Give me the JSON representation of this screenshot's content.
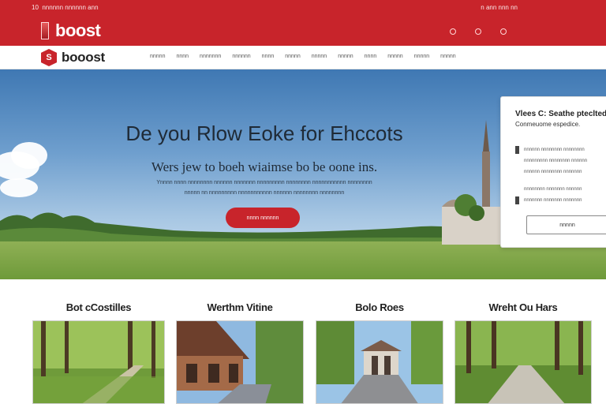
{
  "topbar": {
    "left_text": "10   nnnnnn  nnnnnn  ann",
    "right_text": "n  ann nnn nn",
    "brand": "boost"
  },
  "nav": {
    "logo_letter": "S",
    "logo_text": "booost",
    "links": [
      "nnnnn",
      "nnnn",
      "nnnnnnn",
      "nnnnnn",
      "nnnn",
      "nnnnn",
      "nnnnn",
      "nnnnn",
      "nnnn",
      "nnnnn",
      "nnnnn",
      "nnnnn"
    ]
  },
  "hero": {
    "title": "De you Rlow Eoke for Ehccots",
    "subtitle": "Wers jew to boeh wiaimse bo be oone ins.",
    "line1": "Ynnnn nnnn nnnnnnnn nnnnnn nnnnnnn nnnnnnnnn nnnnnnnn nnnnnnnnnnn nnnnnnnn",
    "line2": "nnnnn nn nnnnnnnnn nnnnnnnnnnn nnnnnn nnnnnnnn nnnnnnnn",
    "cta": "nnnn nnnnnn"
  },
  "card": {
    "title": "Vlees C: Seathe pteclted",
    "subtitle": "Conmeuome espedice.",
    "rows": [
      "nnnnnn nnnnnnnn nnnnnnnn",
      "nnnnnnnnn nnnnnnnn nnnnnn",
      "nnnnnn nnnnnnnn nnnnnnn",
      "nnnnnnnn nnnnnnn nnnnnn",
      "nnnnnnn nnnnnnn nnnnnnn"
    ],
    "button": "nnnnn"
  },
  "sections": [
    {
      "title": "Bot сCostilles"
    },
    {
      "title": "Werthm Vitine"
    },
    {
      "title": "Bolo Roes"
    },
    {
      "title": "Wreht Ou Hars"
    }
  ],
  "colors": {
    "brand_red": "#c8242b",
    "sky_top": "#3f78b3",
    "grass": "#7ea248"
  }
}
